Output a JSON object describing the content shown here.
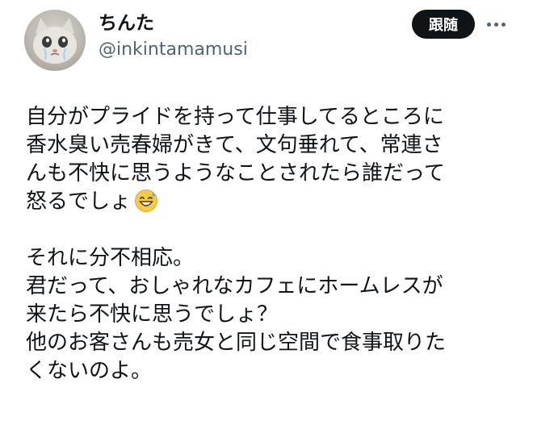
{
  "user": {
    "display_name": "ちんた",
    "handle": "@inkintamamusi",
    "avatar_icon": "crying-cat-avatar"
  },
  "actions": {
    "follow_label": "跟随",
    "more_icon": "ellipsis-icon"
  },
  "tweet": {
    "paragraphs": [
      {
        "lines": [
          "自分がプライドを持って仕事してるところに",
          "香水臭い売春婦がきて、文句垂れて、常連さ",
          "んも不快に思うようなことされたら誰だって",
          "怒るでしょ"
        ],
        "trailing_emoji": "grinning-face-with-sweat-emoji"
      },
      {
        "lines": [
          "それに分不相応。",
          "君だって、おしゃれなカフェにホームレスが",
          "来たら不快に思うでしょ？",
          "他のお客さんも売女と同じ空間で食事取りた",
          "くないのよ。"
        ]
      }
    ]
  },
  "colors": {
    "text": "#0f1419",
    "secondary_text": "#536471",
    "button_bg": "#0f1419",
    "button_text": "#ffffff",
    "emoji_yellow": "#f7c948",
    "sweat_blue": "#5dade2"
  }
}
